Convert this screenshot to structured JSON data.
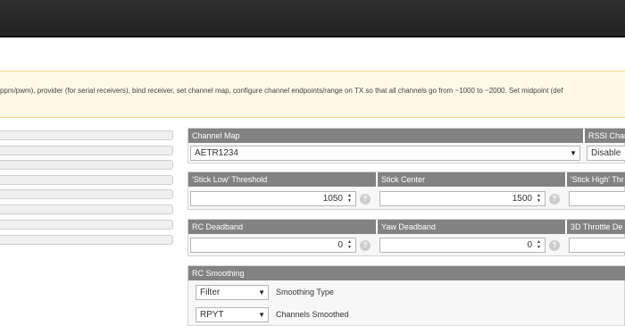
{
  "note": {
    "text": "ppm/pwm), provider (for serial receivers), bind receiver, set channel map, configure channel endpoints/range on TX so that all channels go from ~1000 to ~2000. Set midpoint (def"
  },
  "channel_map": {
    "header": "Channel Map",
    "value": "AETR1234"
  },
  "rssi": {
    "header": "RSSI Chan",
    "value": "Disable"
  },
  "stick_low": {
    "header": "'Stick Low' Threshold",
    "value": "1050"
  },
  "stick_center": {
    "header": "Stick Center",
    "value": "1500"
  },
  "stick_high": {
    "header": "'Stick High' Thr"
  },
  "rc_deadband": {
    "header": "RC Deadband",
    "value": "0"
  },
  "yaw_deadband": {
    "header": "Yaw Deadband",
    "value": "0"
  },
  "throttle_deadband": {
    "header": "3D Throttle De"
  },
  "rc_smoothing": {
    "header": "RC Smoothing",
    "type_value": "Filter",
    "type_label": "Smoothing Type",
    "channels_value": "RPYT",
    "channels_label": "Channels Smoothed"
  },
  "icons": {
    "help": "?",
    "dropdown": "▼",
    "spin_up": "▲",
    "spin_down": "▼"
  }
}
